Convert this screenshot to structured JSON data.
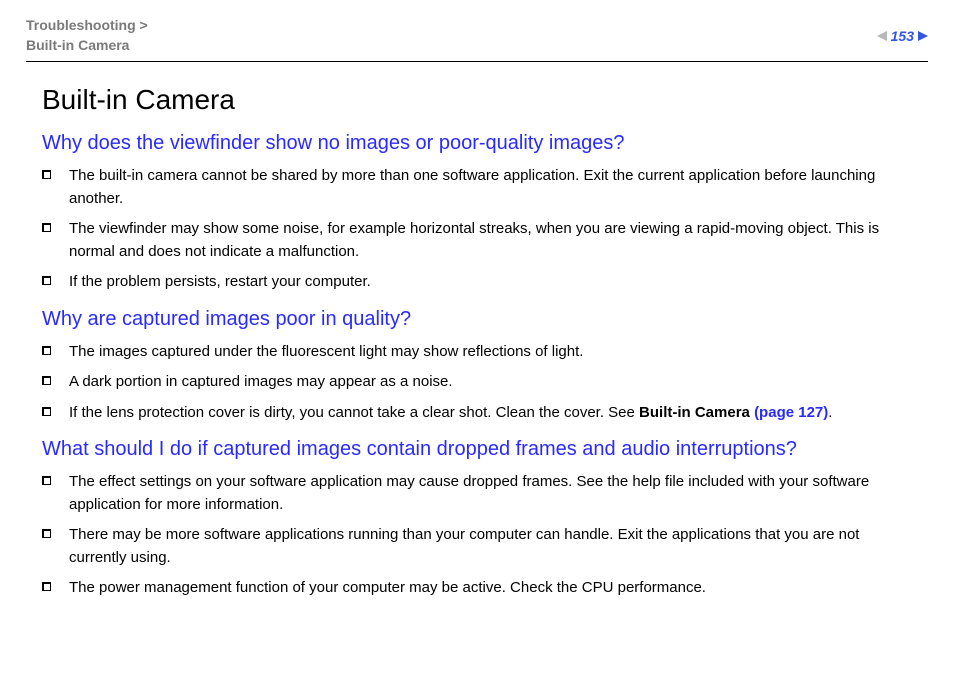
{
  "header": {
    "breadcrumb_section": "Troubleshooting",
    "breadcrumb_sep": " > ",
    "breadcrumb_page": "Built-in Camera",
    "page_number": "153"
  },
  "title": "Built-in Camera",
  "sections": [
    {
      "question": "Why does the viewfinder show no images or poor-quality images?",
      "items": [
        {
          "text": "The built-in camera cannot be shared by more than one software application. Exit the current application before launching another."
        },
        {
          "text": "The viewfinder may show some noise, for example horizontal streaks, when you are viewing a rapid-moving object. This is normal and does not indicate a malfunction."
        },
        {
          "text": "If the problem persists, restart your computer."
        }
      ]
    },
    {
      "question": "Why are captured images poor in quality?",
      "items": [
        {
          "text": "The images captured under the fluorescent light may show reflections of light."
        },
        {
          "text": "A dark portion in captured images may appear as a noise."
        },
        {
          "text_pre": "If the lens protection cover is dirty, you cannot take a clear shot. Clean the cover. See ",
          "bold": "Built-in Camera ",
          "link": "(page 127)",
          "text_post": "."
        }
      ]
    },
    {
      "question": "What should I do if captured images contain dropped frames and audio interruptions?",
      "items": [
        {
          "text": "The effect settings on your software application may cause dropped frames. See the help file included with your software application for more information."
        },
        {
          "text": "There may be more software applications running than your computer can handle. Exit the applications that you are not currently using."
        },
        {
          "text": "The power management function of your computer may be active. Check the CPU performance."
        }
      ]
    }
  ]
}
